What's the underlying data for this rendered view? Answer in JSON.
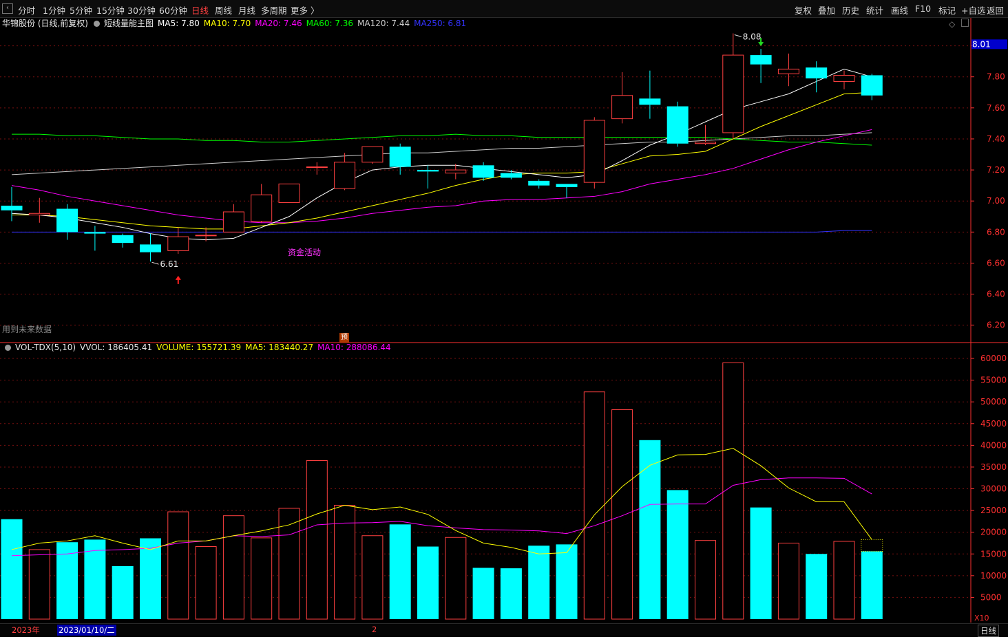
{
  "toolbar": {
    "left": [
      "分时",
      "1分钟",
      "5分钟",
      "15分钟",
      "30分钟",
      "60分钟",
      "日线",
      "周线",
      "月线",
      "多周期",
      "更多 〉"
    ],
    "active": "日线",
    "right": [
      "复权",
      "叠加",
      "历史",
      "统计",
      "画线",
      "F10",
      "标记",
      "+自选",
      "返回"
    ]
  },
  "header": {
    "stock": "华锦股份 (日线,前复权)",
    "indicator": "短线量能主图",
    "ma5": "MA5: 7.80",
    "ma10": "MA10: 7.70",
    "ma20": "MA20: 7.46",
    "ma60": "MA60: 7.36",
    "ma120": "MA120: 7.44",
    "ma250": "MA250: 6.81"
  },
  "vol_header": {
    "name": "VOL-TDX(5,10)",
    "vvol": "VVOL: 186405.41",
    "volume": "VOLUME: 155721.39",
    "ma5": "MA5: 183440.27",
    "ma10": "MA10: 288086.44"
  },
  "notes": {
    "future_data": "用到未来数据",
    "fund_activity": "资金活动",
    "preview": "预",
    "high_label": "8.08",
    "low_label": "6.61",
    "price_tag": "8.01",
    "x10": "X10"
  },
  "bottom": {
    "year": "2023年",
    "date": "2023/01/10/二",
    "month": "2",
    "period": "日线"
  },
  "colors": {
    "up": "#ff4040",
    "down": "#00ffff",
    "ma5": "#ffffff",
    "ma10": "#ffff00",
    "ma20": "#ff00ff",
    "ma60": "#00ff00",
    "ma120": "#cccccc",
    "ma250": "#3333ff",
    "grid": "#7a1010",
    "axis": "#ff3030"
  },
  "chart_data": {
    "type": "candlestick",
    "price_ylim": [
      6.15,
      8.1
    ],
    "price_ticks": [
      6.2,
      6.4,
      6.6,
      6.8,
      7.0,
      7.2,
      7.4,
      7.6,
      7.8,
      8.0
    ],
    "candles": [
      {
        "o": 6.97,
        "c": 6.94,
        "h": 7.09,
        "l": 6.87
      },
      {
        "o": 6.91,
        "c": 6.92,
        "h": 7.02,
        "l": 6.86
      },
      {
        "o": 6.95,
        "c": 6.8,
        "h": 6.98,
        "l": 6.75
      },
      {
        "o": 6.8,
        "c": 6.79,
        "h": 6.84,
        "l": 6.68
      },
      {
        "o": 6.78,
        "c": 6.73,
        "h": 6.79,
        "l": 6.7
      },
      {
        "o": 6.72,
        "c": 6.67,
        "h": 6.79,
        "l": 6.61
      },
      {
        "o": 6.68,
        "c": 6.77,
        "h": 6.83,
        "l": 6.66
      },
      {
        "o": 6.78,
        "c": 6.78,
        "h": 6.83,
        "l": 6.74
      },
      {
        "o": 6.8,
        "c": 6.93,
        "h": 6.98,
        "l": 6.8
      },
      {
        "o": 6.87,
        "c": 7.04,
        "h": 7.11,
        "l": 6.86
      },
      {
        "o": 6.99,
        "c": 7.11,
        "h": 7.11,
        "l": 6.99
      },
      {
        "o": 7.22,
        "c": 7.22,
        "h": 7.25,
        "l": 7.17
      },
      {
        "o": 7.08,
        "c": 7.25,
        "h": 7.31,
        "l": 7.07
      },
      {
        "o": 7.25,
        "c": 7.35,
        "h": 7.35,
        "l": 7.24
      },
      {
        "o": 7.35,
        "c": 7.22,
        "h": 7.37,
        "l": 7.17
      },
      {
        "o": 7.2,
        "c": 7.19,
        "h": 7.23,
        "l": 7.08
      },
      {
        "o": 7.18,
        "c": 7.2,
        "h": 7.24,
        "l": 7.14
      },
      {
        "o": 7.23,
        "c": 7.15,
        "h": 7.25,
        "l": 7.13
      },
      {
        "o": 7.18,
        "c": 7.15,
        "h": 7.2,
        "l": 7.14
      },
      {
        "o": 7.13,
        "c": 7.1,
        "h": 7.14,
        "l": 7.08
      },
      {
        "o": 7.11,
        "c": 7.09,
        "h": 7.11,
        "l": 7.02
      },
      {
        "o": 7.12,
        "c": 7.52,
        "h": 7.54,
        "l": 7.08
      },
      {
        "o": 7.53,
        "c": 7.68,
        "h": 7.83,
        "l": 7.5
      },
      {
        "o": 7.66,
        "c": 7.62,
        "h": 7.84,
        "l": 7.53
      },
      {
        "o": 7.61,
        "c": 7.37,
        "h": 7.64,
        "l": 7.35
      },
      {
        "o": 7.37,
        "c": 7.38,
        "h": 7.49,
        "l": 7.36
      },
      {
        "o": 7.44,
        "c": 7.94,
        "h": 8.08,
        "l": 7.4
      },
      {
        "o": 7.94,
        "c": 7.88,
        "h": 7.98,
        "l": 7.76
      },
      {
        "o": 7.82,
        "c": 7.85,
        "h": 7.95,
        "l": 7.74
      },
      {
        "o": 7.86,
        "c": 7.79,
        "h": 7.9,
        "l": 7.7
      },
      {
        "o": 7.77,
        "c": 7.81,
        "h": 7.84,
        "l": 7.72
      },
      {
        "o": 7.81,
        "c": 7.68,
        "h": 7.82,
        "l": 7.65
      }
    ],
    "ma5": [
      6.92,
      6.91,
      6.89,
      6.86,
      6.83,
      6.79,
      6.76,
      6.75,
      6.76,
      6.83,
      6.9,
      7.02,
      7.12,
      7.2,
      7.22,
      7.23,
      7.23,
      7.21,
      7.19,
      7.17,
      7.15,
      7.17,
      7.26,
      7.36,
      7.43,
      7.51,
      7.59,
      7.64,
      7.69,
      7.77,
      7.85,
      7.8
    ],
    "ma10": [
      6.91,
      6.91,
      6.9,
      6.88,
      6.86,
      6.84,
      6.83,
      6.82,
      6.82,
      6.84,
      6.86,
      6.89,
      6.93,
      6.97,
      7.01,
      7.05,
      7.1,
      7.14,
      7.17,
      7.18,
      7.18,
      7.19,
      7.24,
      7.29,
      7.3,
      7.32,
      7.4,
      7.48,
      7.55,
      7.62,
      7.69,
      7.7
    ],
    "ma20": [
      7.1,
      7.07,
      7.03,
      7.0,
      6.97,
      6.94,
      6.91,
      6.89,
      6.87,
      6.86,
      6.86,
      6.87,
      6.89,
      6.92,
      6.94,
      6.96,
      6.97,
      7.0,
      7.01,
      7.01,
      7.02,
      7.03,
      7.06,
      7.11,
      7.14,
      7.17,
      7.21,
      7.27,
      7.33,
      7.38,
      7.42,
      7.46
    ],
    "ma60": [
      7.43,
      7.43,
      7.42,
      7.42,
      7.41,
      7.4,
      7.4,
      7.39,
      7.39,
      7.38,
      7.38,
      7.39,
      7.4,
      7.41,
      7.42,
      7.42,
      7.43,
      7.42,
      7.42,
      7.41,
      7.41,
      7.41,
      7.41,
      7.41,
      7.41,
      7.41,
      7.4,
      7.39,
      7.38,
      7.38,
      7.37,
      7.36
    ],
    "ma120": [
      7.17,
      7.18,
      7.19,
      7.2,
      7.21,
      7.22,
      7.23,
      7.24,
      7.25,
      7.26,
      7.27,
      7.28,
      7.29,
      7.3,
      7.31,
      7.31,
      7.32,
      7.33,
      7.34,
      7.34,
      7.35,
      7.36,
      7.37,
      7.38,
      7.38,
      7.39,
      7.4,
      7.41,
      7.42,
      7.42,
      7.43,
      7.44
    ],
    "ma250": [
      6.8,
      6.8,
      6.8,
      6.8,
      6.8,
      6.8,
      6.8,
      6.8,
      6.8,
      6.8,
      6.8,
      6.8,
      6.8,
      6.8,
      6.8,
      6.8,
      6.8,
      6.8,
      6.8,
      6.8,
      6.8,
      6.8,
      6.8,
      6.8,
      6.8,
      6.8,
      6.8,
      6.8,
      6.8,
      6.8,
      6.81,
      6.81
    ],
    "vol_ylim": [
      0,
      60800
    ],
    "vol_ticks": [
      5000,
      10000,
      15000,
      20000,
      25000,
      30000,
      35000,
      40000,
      45000,
      50000,
      55000,
      60000
    ],
    "volume": [
      23000,
      16000,
      17700,
      18300,
      12200,
      18600,
      24700,
      16700,
      23800,
      18700,
      25500,
      36500,
      26200,
      19200,
      21800,
      16700,
      18800,
      11800,
      11700,
      16900,
      17200,
      52300,
      48200,
      41200,
      29700,
      18100,
      59000,
      25700,
      17500,
      15000,
      17900,
      15600
    ],
    "vol_ma5": [
      16000,
      17500,
      18000,
      19200,
      17500,
      16000,
      18000,
      18000,
      19200,
      20300,
      21700,
      24200,
      26200,
      25200,
      25800,
      24100,
      20400,
      17500,
      16500,
      15000,
      15300,
      24000,
      30500,
      35400,
      37800,
      37900,
      39300,
      35300,
      30200,
      27000,
      27000,
      18300
    ],
    "vol_ma10": [
      14600,
      14800,
      15000,
      15800,
      16000,
      16300,
      17500,
      18000,
      19200,
      19000,
      19400,
      21700,
      22100,
      22200,
      22500,
      21500,
      21000,
      20600,
      20500,
      20300,
      19700,
      21500,
      23800,
      26400,
      26500,
      26500,
      30800,
      32100,
      32500,
      32500,
      32400,
      28800
    ]
  }
}
